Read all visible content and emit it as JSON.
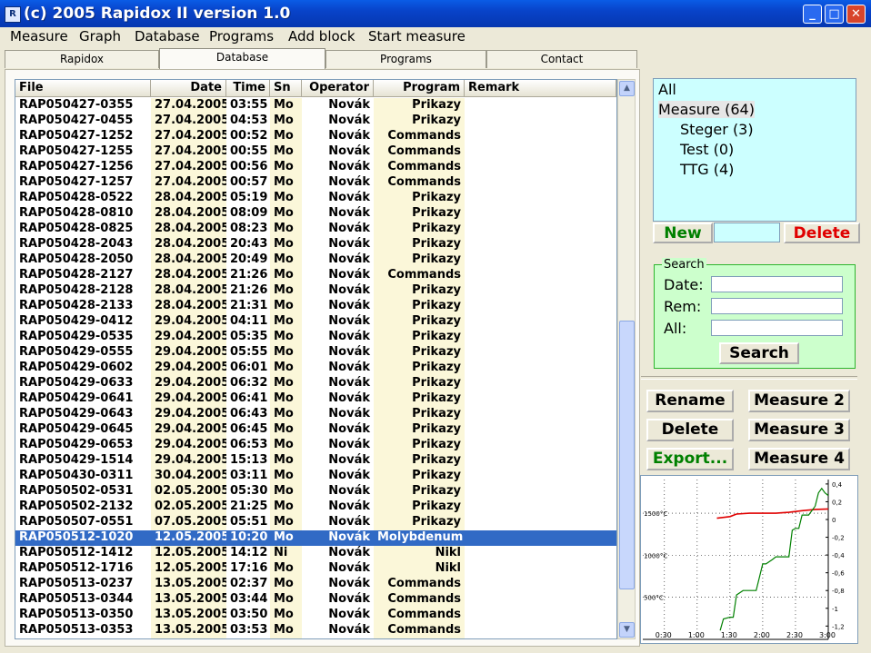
{
  "window": {
    "title": "(c) 2005 Rapidox II version 1.0",
    "minimize": "_",
    "maximize": "□",
    "close": "✕"
  },
  "menu": [
    "Measure",
    "Graph",
    "Database",
    "Programs",
    "Add block",
    "Start measure"
  ],
  "tabs": [
    "Rapidox",
    "Database",
    "Programs",
    "Contact"
  ],
  "table": {
    "columns": [
      "File",
      "Date",
      "Time",
      "Sn",
      "Operator",
      "Program",
      "Remark"
    ],
    "rows": [
      [
        "RAP050427-0355",
        "27.04.2005",
        "03:55",
        "Mo",
        "Novák",
        "Prikazy",
        ""
      ],
      [
        "RAP050427-0455",
        "27.04.2005",
        "04:53",
        "Mo",
        "Novák",
        "Prikazy",
        ""
      ],
      [
        "RAP050427-1252",
        "27.04.2005",
        "00:52",
        "Mo",
        "Novák",
        "Commands",
        ""
      ],
      [
        "RAP050427-1255",
        "27.04.2005",
        "00:55",
        "Mo",
        "Novák",
        "Commands",
        ""
      ],
      [
        "RAP050427-1256",
        "27.04.2005",
        "00:56",
        "Mo",
        "Novák",
        "Commands",
        ""
      ],
      [
        "RAP050427-1257",
        "27.04.2005",
        "00:57",
        "Mo",
        "Novák",
        "Commands",
        ""
      ],
      [
        "RAP050428-0522",
        "28.04.2005",
        "05:19",
        "Mo",
        "Novák",
        "Prikazy",
        ""
      ],
      [
        "RAP050428-0810",
        "28.04.2005",
        "08:09",
        "Mo",
        "Novák",
        "Prikazy",
        ""
      ],
      [
        "RAP050428-0825",
        "28.04.2005",
        "08:23",
        "Mo",
        "Novák",
        "Prikazy",
        ""
      ],
      [
        "RAP050428-2043",
        "28.04.2005",
        "20:43",
        "Mo",
        "Novák",
        "Prikazy",
        ""
      ],
      [
        "RAP050428-2050",
        "28.04.2005",
        "20:49",
        "Mo",
        "Novák",
        "Prikazy",
        ""
      ],
      [
        "RAP050428-2127",
        "28.04.2005",
        "21:26",
        "Mo",
        "Novák",
        "Commands",
        ""
      ],
      [
        "RAP050428-2128",
        "28.04.2005",
        "21:26",
        "Mo",
        "Novák",
        "Prikazy",
        ""
      ],
      [
        "RAP050428-2133",
        "28.04.2005",
        "21:31",
        "Mo",
        "Novák",
        "Prikazy",
        ""
      ],
      [
        "RAP050429-0412",
        "29.04.2005",
        "04:11",
        "Mo",
        "Novák",
        "Prikazy",
        ""
      ],
      [
        "RAP050429-0535",
        "29.04.2005",
        "05:35",
        "Mo",
        "Novák",
        "Prikazy",
        ""
      ],
      [
        "RAP050429-0555",
        "29.04.2005",
        "05:55",
        "Mo",
        "Novák",
        "Prikazy",
        ""
      ],
      [
        "RAP050429-0602",
        "29.04.2005",
        "06:01",
        "Mo",
        "Novák",
        "Prikazy",
        ""
      ],
      [
        "RAP050429-0633",
        "29.04.2005",
        "06:32",
        "Mo",
        "Novák",
        "Prikazy",
        ""
      ],
      [
        "RAP050429-0641",
        "29.04.2005",
        "06:41",
        "Mo",
        "Novák",
        "Prikazy",
        ""
      ],
      [
        "RAP050429-0643",
        "29.04.2005",
        "06:43",
        "Mo",
        "Novák",
        "Prikazy",
        ""
      ],
      [
        "RAP050429-0645",
        "29.04.2005",
        "06:45",
        "Mo",
        "Novák",
        "Prikazy",
        ""
      ],
      [
        "RAP050429-0653",
        "29.04.2005",
        "06:53",
        "Mo",
        "Novák",
        "Prikazy",
        ""
      ],
      [
        "RAP050429-1514",
        "29.04.2005",
        "15:13",
        "Mo",
        "Novák",
        "Prikazy",
        ""
      ],
      [
        "RAP050430-0311",
        "30.04.2005",
        "03:11",
        "Mo",
        "Novák",
        "Prikazy",
        ""
      ],
      [
        "RAP050502-0531",
        "02.05.2005",
        "05:30",
        "Mo",
        "Novák",
        "Prikazy",
        ""
      ],
      [
        "RAP050502-2132",
        "02.05.2005",
        "21:25",
        "Mo",
        "Novák",
        "Prikazy",
        ""
      ],
      [
        "RAP050507-0551",
        "07.05.2005",
        "05:51",
        "Mo",
        "Novák",
        "Prikazy",
        ""
      ],
      [
        "RAP050512-1020",
        "12.05.2005",
        "10:20",
        "Mo",
        "Novák",
        "Molybdenum",
        ""
      ],
      [
        "RAP050512-1412",
        "12.05.2005",
        "14:12",
        "Ni",
        "Novák",
        "Nikl",
        ""
      ],
      [
        "RAP050512-1716",
        "12.05.2005",
        "17:16",
        "Mo",
        "Novák",
        "Nikl",
        ""
      ],
      [
        "RAP050513-0237",
        "13.05.2005",
        "02:37",
        "Mo",
        "Novák",
        "Commands",
        ""
      ],
      [
        "RAP050513-0344",
        "13.05.2005",
        "03:44",
        "Mo",
        "Novák",
        "Commands",
        ""
      ],
      [
        "RAP050513-0350",
        "13.05.2005",
        "03:50",
        "Mo",
        "Novák",
        "Commands",
        ""
      ],
      [
        "RAP050513-0353",
        "13.05.2005",
        "03:53",
        "Mo",
        "Novák",
        "Commands",
        ""
      ]
    ],
    "selected_index": 28
  },
  "categories": [
    {
      "label": "All"
    },
    {
      "label": "Measure (64)"
    },
    {
      "label": "Steger (3)"
    },
    {
      "label": "Test (0)"
    },
    {
      "label": "TTG (4)"
    }
  ],
  "category_buttons": {
    "new": "New",
    "delete": "Delete",
    "new_value": ""
  },
  "search": {
    "legend": "Search",
    "date_label": "Date:",
    "rem_label": "Rem:",
    "all_label": "All:",
    "date_value": "",
    "rem_value": "",
    "all_value": "",
    "button": "Search"
  },
  "actions": {
    "rename": "Rename",
    "delete": "Delete",
    "export": "Export...",
    "measure2": "Measure 2",
    "measure3": "Measure 3",
    "measure4": "Measure 4"
  },
  "colors": {
    "category_bg": "#ccffff",
    "search_bg": "#ccffcc",
    "new_text": "#008000",
    "delete_text": "#e00000",
    "selection": "#316ac5",
    "temp_line": "#e00000",
    "signal_line": "#008000"
  },
  "chart_data": {
    "type": "line",
    "x_ticks": [
      "0:30",
      "1:00",
      "1:30",
      "2:00",
      "2:30",
      "3:00"
    ],
    "y_left_ticks": [
      "1500°C",
      "1000°C",
      "500°C"
    ],
    "y_right_ticks": [
      "0,4",
      "0,2",
      "0",
      "-0,2",
      "-0,4",
      "-0,6",
      "-0,8",
      "-1",
      "-1,2"
    ],
    "series": [
      {
        "axis": "left",
        "x": [
          1.3,
          1.5,
          1.6,
          1.8,
          2.0,
          2.2,
          2.4,
          2.6,
          2.8,
          3.0
        ],
        "values": [
          1440,
          1460,
          1490,
          1500,
          1500,
          1500,
          1510,
          1530,
          1545,
          1550
        ]
      },
      {
        "axis": "right",
        "x": [
          1.35,
          1.4,
          1.5,
          1.55,
          1.6,
          1.7,
          1.8,
          1.9,
          2.0,
          2.05,
          2.15,
          2.2,
          2.3,
          2.4,
          2.45,
          2.5,
          2.55,
          2.6,
          2.7,
          2.8,
          2.85,
          2.9,
          2.95,
          3.0
        ],
        "values": [
          -1.25,
          -1.12,
          -1.1,
          -1.1,
          -0.85,
          -0.8,
          -0.8,
          -0.8,
          -0.5,
          -0.5,
          -0.45,
          -0.42,
          -0.42,
          -0.42,
          -0.12,
          -0.1,
          -0.1,
          0.05,
          0.05,
          0.15,
          0.3,
          0.35,
          0.3,
          0.27
        ]
      }
    ],
    "xlim": [
      0.17,
      3.0
    ],
    "ylim_left": [
      0,
      1900
    ],
    "ylim_right": [
      -1.35,
      0.45
    ]
  }
}
